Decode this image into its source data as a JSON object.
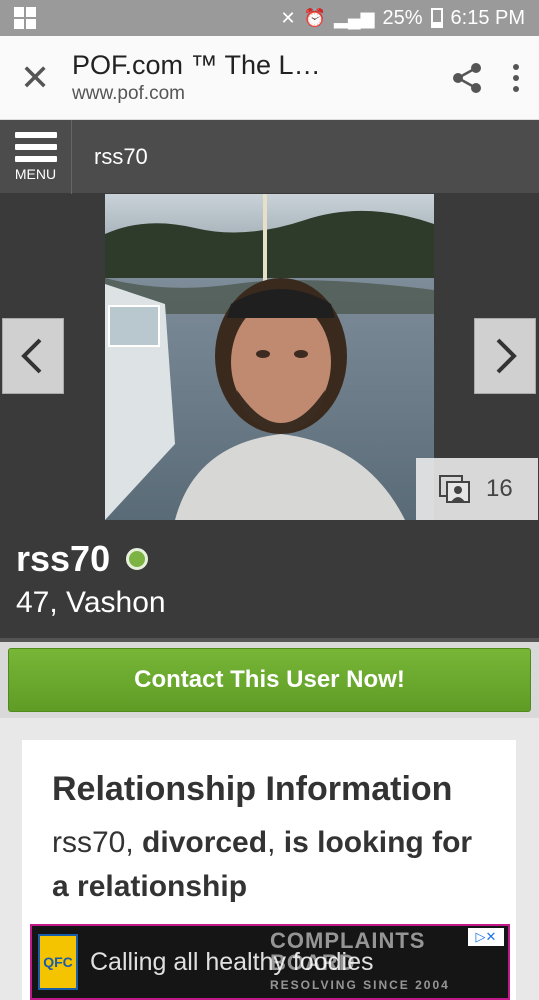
{
  "status_bar": {
    "battery": "25%",
    "time": "6:15 PM"
  },
  "browser": {
    "title": "POF.com ™ The L…",
    "url": "www.pof.com"
  },
  "menu_bar": {
    "menu_label": "MENU",
    "username": "rss70"
  },
  "profile": {
    "username": "rss70",
    "age_location": "47, Vashon",
    "photo_count": "16",
    "online_color": "#7cb342"
  },
  "contact": {
    "label": "Contact This User Now!"
  },
  "relationship": {
    "heading": "Relationship Information",
    "username": "rss70",
    "status": "divorced",
    "looking_for": "is looking for a relationship"
  },
  "ad": {
    "logo_text": "QFC",
    "text": "Calling all healthy foodies"
  },
  "watermark": {
    "line1": "COMPLAINTS",
    "line2": "BOARD",
    "line3": "RESOLVING SINCE 2004"
  }
}
